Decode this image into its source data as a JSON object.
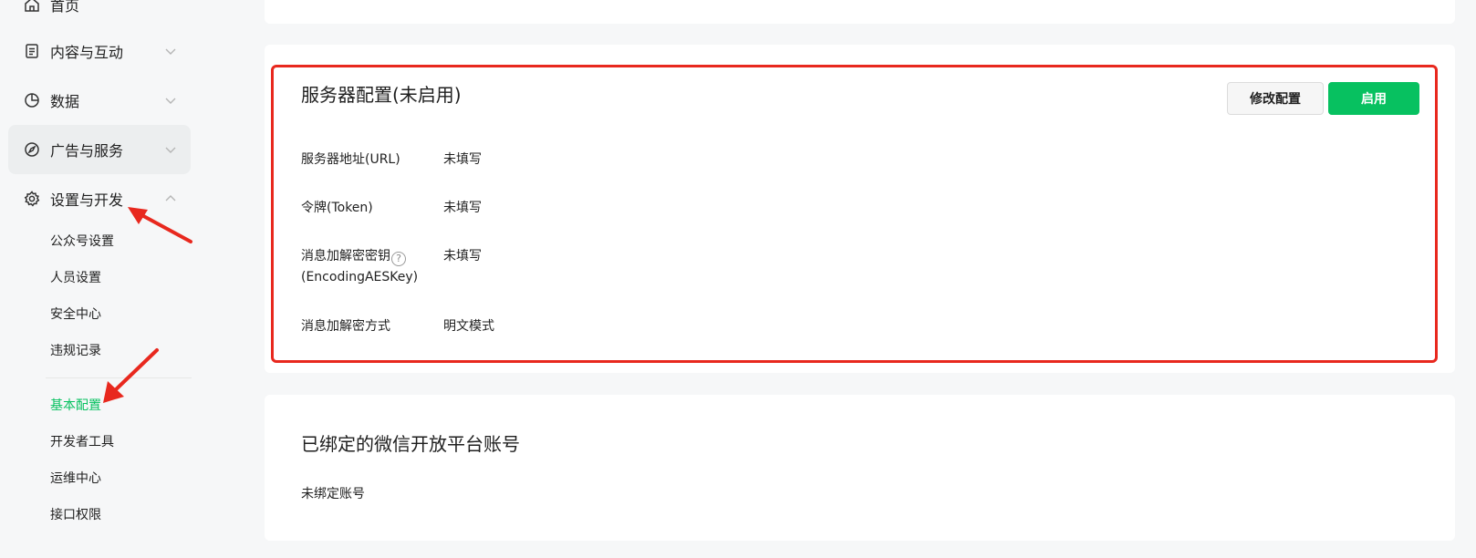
{
  "sidebar": {
    "items": [
      {
        "label": "首页",
        "icon": "home-icon"
      },
      {
        "label": "内容与互动",
        "icon": "document-icon"
      },
      {
        "label": "数据",
        "icon": "pie-chart-icon"
      },
      {
        "label": "广告与服务",
        "icon": "compass-icon"
      },
      {
        "label": "设置与开发",
        "icon": "gear-icon"
      }
    ],
    "sub_items": [
      {
        "label": "公众号设置"
      },
      {
        "label": "人员设置"
      },
      {
        "label": "安全中心"
      },
      {
        "label": "违规记录"
      },
      {
        "label": "基本配置"
      },
      {
        "label": "开发者工具"
      },
      {
        "label": "运维中心"
      },
      {
        "label": "接口权限"
      }
    ]
  },
  "server_config": {
    "title": "服务器配置(未启用)",
    "modify_button": "修改配置",
    "enable_button": "启用",
    "fields": [
      {
        "label": "服务器地址(URL)",
        "value": "未填写"
      },
      {
        "label": "令牌(Token)",
        "value": "未填写"
      },
      {
        "label_line1": "消息加解密密钥",
        "label_line2": "(EncodingAESKey)",
        "help": "?",
        "value": "未填写"
      },
      {
        "label": "消息加解密方式",
        "value": "明文模式"
      }
    ]
  },
  "bound_accounts": {
    "title": "已绑定的微信开放平台账号",
    "empty_text": "未绑定账号"
  },
  "colors": {
    "accent_green": "#07c160",
    "annotation_red": "#e8281e"
  }
}
